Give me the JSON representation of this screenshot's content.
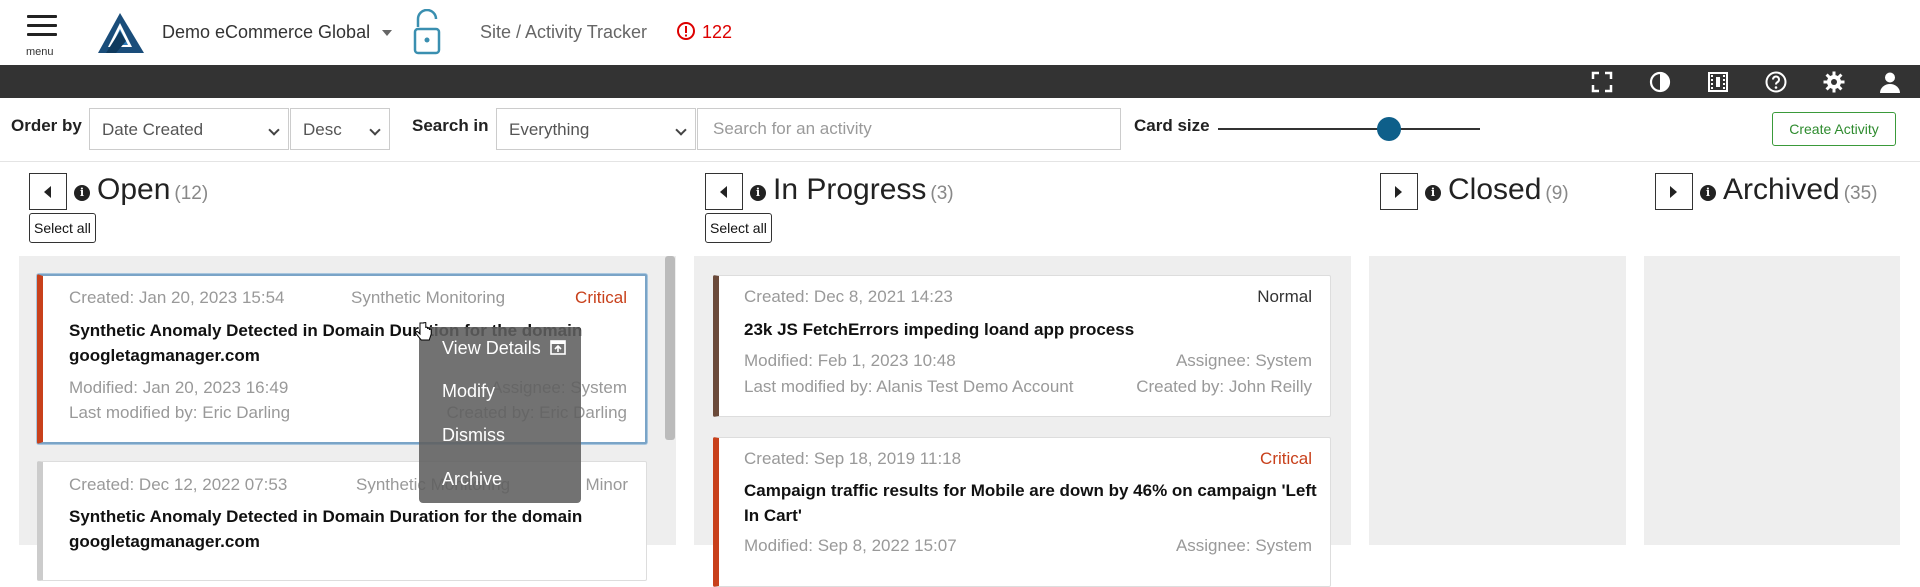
{
  "header": {
    "menu_label": "menu",
    "org_name": "Demo eCommerce Global",
    "breadcrumb": "Site / Activity Tracker",
    "alert_count": "122",
    "alert_color": "#dd0000"
  },
  "toolbar": {
    "background": "#333333",
    "icons": [
      "fullscreen-icon",
      "contrast-icon",
      "film-icon",
      "help-icon",
      "settings-icon",
      "user-icon"
    ]
  },
  "filters": {
    "order_by_label": "Order by",
    "order_by_value": "Date Created",
    "order_dir_value": "Desc",
    "search_in_label": "Search in",
    "search_in_value": "Everything",
    "search_placeholder": "Search for an activity",
    "card_size_label": "Card size",
    "card_size_fraction": 0.65,
    "create_button": "Create Activity"
  },
  "columns": [
    {
      "title": "Open",
      "count": "(12)",
      "select_all": "Select all"
    },
    {
      "title": "In Progress",
      "count": "(3)",
      "select_all": "Select all"
    },
    {
      "title": "Closed",
      "count": "(9)"
    },
    {
      "title": "Archived",
      "count": "(35)"
    }
  ],
  "open_cards": [
    {
      "created": "Created: Jan 20, 2023 15:54",
      "source": "Synthetic Monitoring",
      "priority": "Critical",
      "title_line1": "Synthetic Anomaly Detected in Domain Duration for the domain",
      "title_line2": "googletagmanager.com",
      "modified": "Modified: Jan 20, 2023 16:49",
      "assignee": "Assignee: System",
      "last_modified_by": "Last modified by: Eric Darling",
      "created_by": "Created by: Eric Darling"
    },
    {
      "created": "Created: Dec 12, 2022 07:53",
      "source": "Synthetic Monitoring",
      "priority": "Minor",
      "title_line1": "Synthetic Anomaly Detected in Domain Duration for the domain",
      "title_line2": "googletagmanager.com"
    }
  ],
  "progress_cards": [
    {
      "created": "Created: Dec 8, 2021 14:23",
      "priority": "Normal",
      "title_line1": "23k JS FetchErrors impeding loand app process",
      "modified": "Modified: Feb 1, 2023 10:48",
      "assignee": "Assignee: System",
      "last_modified_by": "Last modified by: Alanis Test Demo Account",
      "created_by": "Created by: John Reilly"
    },
    {
      "created": "Created: Sep 18, 2019 11:18",
      "priority": "Critical",
      "title_line1": "Campaign traffic results for Mobile are down by 46% on campaign 'Left",
      "title_line2": "In Cart'",
      "modified": "Modified: Sep 8, 2022 15:07",
      "assignee": "Assignee: System"
    }
  ],
  "context_menu": {
    "view_details": "View Details",
    "modify": "Modify",
    "dismiss": "Dismiss",
    "archive": "Archive"
  },
  "colors": {
    "critical": "#c8401b",
    "normal_border": "#6b4a3a",
    "minor_border": "#cccccc",
    "slider": "#0e5f8a",
    "create_button": "#2e8b2e"
  }
}
